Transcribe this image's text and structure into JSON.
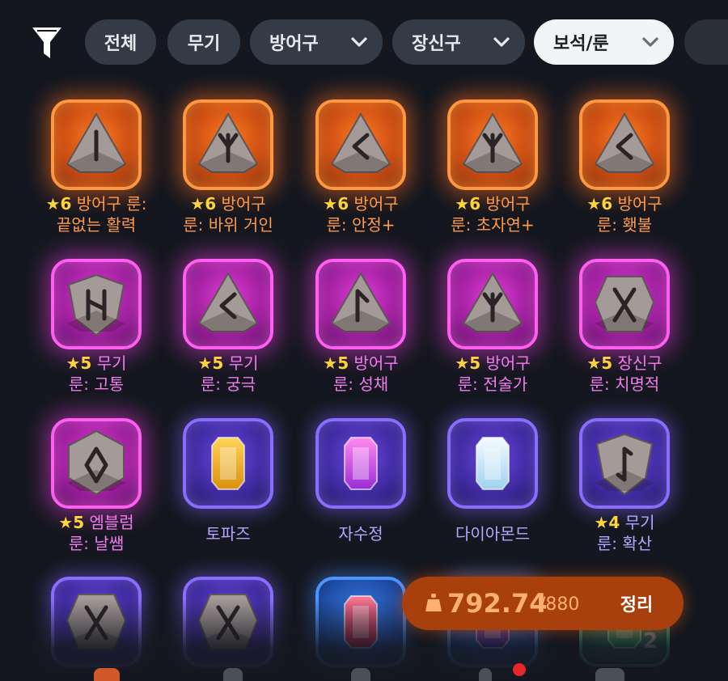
{
  "filter_bar": {
    "filter_icon": "funnel-icon",
    "chips": [
      {
        "label": "전체",
        "dropdown": false,
        "active": false
      },
      {
        "label": "무기",
        "dropdown": false,
        "active": false
      },
      {
        "label": "방어구",
        "dropdown": true,
        "active": false
      },
      {
        "label": "장신구",
        "dropdown": true,
        "active": false
      },
      {
        "label": "보석/룬",
        "dropdown": true,
        "active": true
      }
    ]
  },
  "colors": {
    "legendary_orange": "#ff9640",
    "epic_magenta": "#ff5ef0",
    "rare_purple": "#8a6dff",
    "star_yellow": "#ffd43b",
    "capacity_bg": "#a8400e"
  },
  "items": [
    {
      "grade": "orange",
      "star": "★6",
      "line1": "방어구 룬:",
      "line2": "끝없는 활력",
      "icon": "rune-stone-isa-icon"
    },
    {
      "grade": "orange",
      "star": "★6",
      "line1": "방어구",
      "line2": "룬: 바위 거인",
      "icon": "rune-stone-algiz-icon"
    },
    {
      "grade": "orange",
      "star": "★6",
      "line1": "방어구",
      "line2": "룬: 안정+",
      "icon": "rune-stone-kaunan-icon"
    },
    {
      "grade": "orange",
      "star": "★6",
      "line1": "방어구",
      "line2": "룬: 초자연+",
      "icon": "rune-stone-algiz-icon"
    },
    {
      "grade": "orange",
      "star": "★6",
      "line1": "방어구",
      "line2": "룬: 횃불",
      "icon": "rune-stone-kaunan-icon"
    },
    {
      "grade": "magenta",
      "star": "★5",
      "line1": "무기",
      "line2": "룬: 고통",
      "icon": "rune-stone-hagalaz-icon"
    },
    {
      "grade": "magenta",
      "star": "★5",
      "line1": "무기",
      "line2": "룬: 궁극",
      "icon": "rune-stone-kaunan-icon"
    },
    {
      "grade": "magenta",
      "star": "★5",
      "line1": "방어구",
      "line2": "룬: 성채",
      "icon": "rune-stone-laguz-icon"
    },
    {
      "grade": "magenta",
      "star": "★5",
      "line1": "방어구",
      "line2": "룬: 전술가",
      "icon": "rune-stone-algiz-icon"
    },
    {
      "grade": "magenta",
      "star": "★5",
      "line1": "장신구",
      "line2": "룬: 치명적",
      "icon": "rune-stone-gebo-icon"
    },
    {
      "grade": "magenta",
      "star": "★5",
      "line1": "엠블럼",
      "line2": "룬: 날쌤",
      "icon": "rune-stone-ingwaz-icon"
    },
    {
      "grade": "purple",
      "star": "",
      "line1": "토파즈",
      "line2": "",
      "icon": "topaz-gem-icon"
    },
    {
      "grade": "purple",
      "star": "",
      "line1": "자수정",
      "line2": "",
      "icon": "amethyst-gem-icon"
    },
    {
      "grade": "purple",
      "star": "",
      "line1": "다이아몬드",
      "line2": "",
      "icon": "diamond-gem-icon"
    },
    {
      "grade": "purple",
      "star": "★4",
      "line1": "무기",
      "line2": "룬: 확산",
      "icon": "rune-stone-eihwaz-icon"
    },
    {
      "grade": "purple",
      "star": "",
      "line1": "",
      "line2": "",
      "icon": "rune-stone-gebo-icon"
    },
    {
      "grade": "purple",
      "star": "",
      "line1": "",
      "line2": "",
      "icon": "rune-stone-gebo-icon"
    },
    {
      "grade": "blue",
      "star": "",
      "line1": "",
      "line2": "",
      "icon": "ruby-gem-icon"
    },
    {
      "grade": "blue",
      "star": "",
      "line1": "",
      "line2": "",
      "icon": "gem-icon"
    },
    {
      "grade": "green",
      "star": "",
      "line1": "",
      "line2": "",
      "icon": "emerald-gem-icon"
    }
  ],
  "stack_count": "2",
  "capacity": {
    "icon": "weight-icon",
    "current": "792.74",
    "max": "/880",
    "sort_label": "정리"
  },
  "bottom_nav": {
    "notification_dot_color": "#e8252a"
  }
}
